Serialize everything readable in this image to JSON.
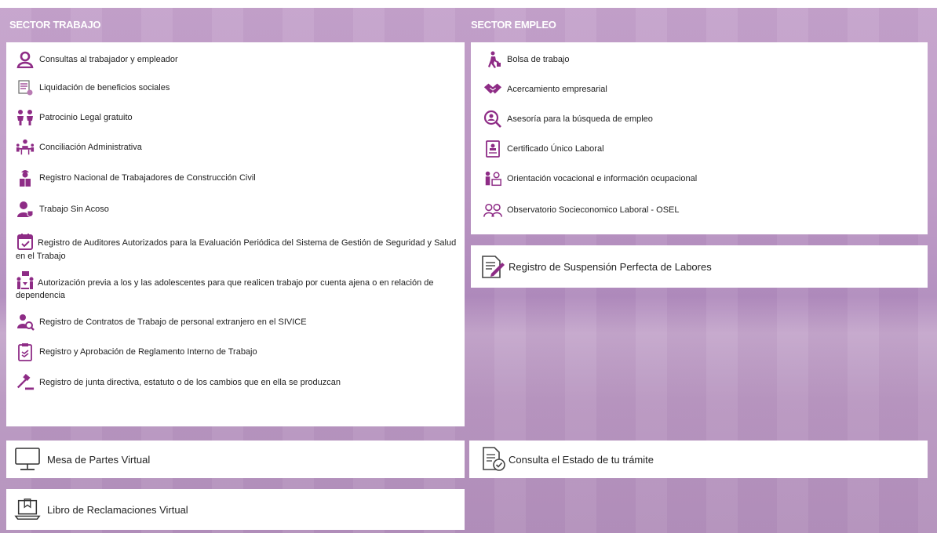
{
  "colors": {
    "accent": "#8e2c86",
    "background": "#bc97c4",
    "panel": "#ffffff"
  },
  "sector_trabajo": {
    "title": "SECTOR TRABAJO",
    "items": [
      {
        "icon": "person-outline-icon",
        "label": "Consultas al trabajador y empleador"
      },
      {
        "icon": "document-calculator-icon",
        "label": "Liquidación de beneficios sociales"
      },
      {
        "icon": "two-people-icon",
        "label": "Patrocinio Legal gratuito"
      },
      {
        "icon": "meeting-table-icon",
        "label": "Conciliación Administrativa"
      },
      {
        "icon": "construction-worker-icon",
        "label": "Registro Nacional de Trabajadores de Construcción Civil"
      },
      {
        "icon": "user-shield-icon",
        "label": "Trabajo Sin Acoso"
      },
      {
        "icon": "calendar-check-icon",
        "label": "Registro de Auditores Autorizados para la Evaluación Periódica del Sistema de Gestión de Seguridad y Salud en el Trabajo"
      },
      {
        "icon": "adolescent-permit-icon",
        "label": "Autorización previa a los y las adolescentes para que realicen trabajo por cuenta ajena o en relación de dependencia"
      },
      {
        "icon": "person-search-icon",
        "label": "Registro de Contratos de Trabajo de personal extranjero en el SIVICE"
      },
      {
        "icon": "checklist-icon",
        "label": "Registro y Aprobación de Reglamento Interno de Trabajo"
      },
      {
        "icon": "gavel-icon",
        "label": "Registro de junta directiva, estatuto o de los cambios que en ella se produzcan"
      }
    ]
  },
  "sector_empleo": {
    "title": "SECTOR EMPLEO",
    "items": [
      {
        "icon": "walking-worker-icon",
        "label": "Bolsa de trabajo"
      },
      {
        "icon": "handshake-icon",
        "label": "Acercamiento empresarial"
      },
      {
        "icon": "search-person-icon",
        "label": "Asesoría para la búsqueda de empleo"
      },
      {
        "icon": "certificate-icon",
        "label": "Certificado Único Laboral"
      },
      {
        "icon": "orientation-icon",
        "label": "Orientación vocacional e información ocupacional"
      },
      {
        "icon": "observatory-people-icon",
        "label": "Observatorio Socieconomico Laboral - OSEL"
      }
    ],
    "suspension_label": "Registro de Suspensión Perfecta de Labores"
  },
  "bottom": {
    "mesa_partes": "Mesa de Partes Virtual",
    "consulta_estado": "Consulta el Estado de tu trámite",
    "libro_reclamaciones": "Libro de Reclamaciones Virtual"
  }
}
